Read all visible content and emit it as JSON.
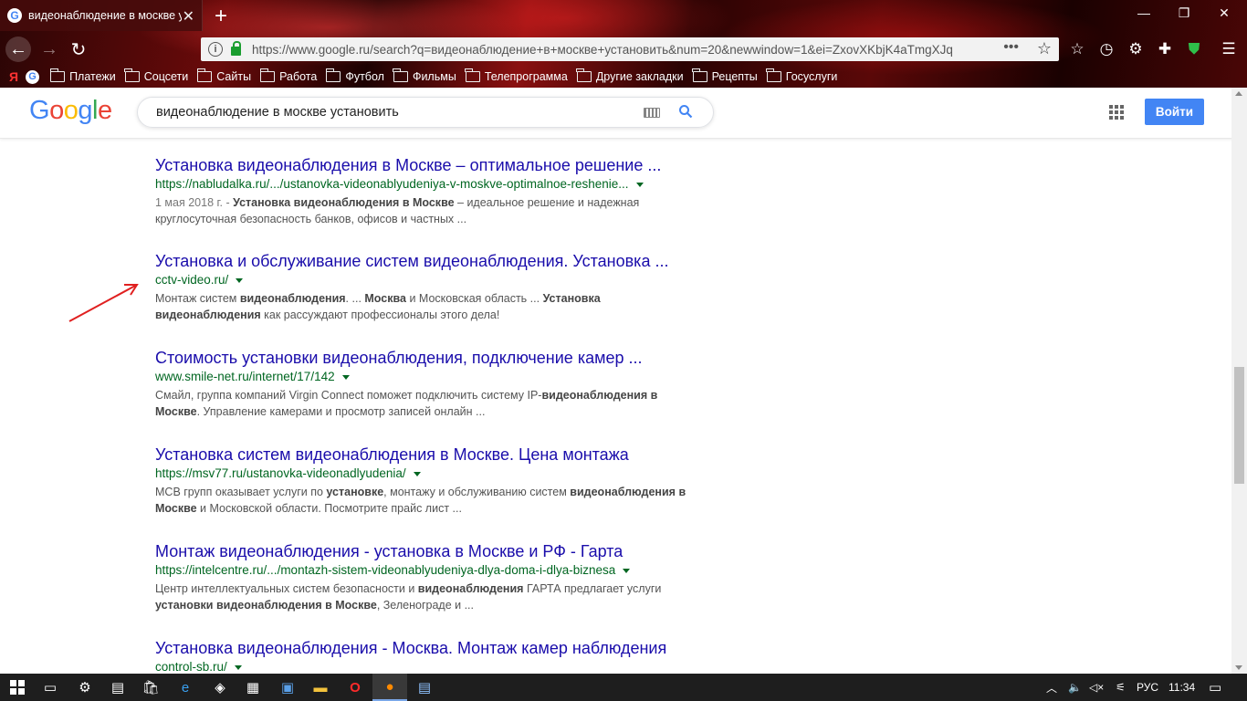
{
  "browser": {
    "tab_title": "видеонаблюдение в москве у",
    "tab_favicon": "G",
    "url": "https://www.google.ru/search?q=видеонаблюдение+в+москве+установить&num=20&newwindow=1&ei=ZxovXKbjK4aTmgXJq",
    "bookmarks": [
      {
        "label": "Платежи"
      },
      {
        "label": "Соцсети"
      },
      {
        "label": "Сайты"
      },
      {
        "label": "Работа"
      },
      {
        "label": "Футбол"
      },
      {
        "label": "Фильмы"
      },
      {
        "label": "Телепрограмма"
      },
      {
        "label": "Другие закладки"
      },
      {
        "label": "Рецепты"
      },
      {
        "label": "Госуслуги"
      }
    ],
    "bookmark_yandex": "Я",
    "bookmark_google": "G"
  },
  "google": {
    "logo_letters": [
      "G",
      "o",
      "o",
      "g",
      "l",
      "e"
    ],
    "query": "видеонаблюдение в москве установить",
    "signin_label": "Войти"
  },
  "results": [
    {
      "title": "Установка видеонаблюдения в Москве – оптимальное решение ...",
      "url": "https://nabludalka.ru/.../ustanovka-videonablyudeniya-v-moskve-optimalnoe-reshenie...",
      "snippet_html": "<span class=\"date\">1 мая 2018 г. - </span><b>Установка видеонаблюдения в Москве</b> – идеальное решение и надежная круглосуточная безопасность банков, офисов и частных ..."
    },
    {
      "title": "Установка и обслуживание систем видеонаблюдения. Установка ...",
      "url": "cctv-video.ru/",
      "snippet_html": "Монтаж систем <b>видеонаблюдения</b>. ... <b>Москва</b> и Московская область ... <b>Установка видеонаблюдения</b> как рассуждают профессионалы этого дела!"
    },
    {
      "title": "Стоимость установки видеонаблюдения, подключение камер ...",
      "url": "www.smile-net.ru/internet/17/142",
      "snippet_html": "Смайл, группа компаний Virgin Connect поможет подключить систему IP-<b>видеонаблюдения в Москве</b>. Управление камерами и просмотр записей онлайн ..."
    },
    {
      "title": "Установка систем видеонаблюдения в Москве. Цена монтажа",
      "url": "https://msv77.ru/ustanovka-videonadlyudenia/",
      "snippet_html": "МСВ групп оказывает услуги по <b>установке</b>, монтажу и обслуживанию систем <b>видеонаблюдения в Москве</b> и Московской области. Посмотрите прайс лист ..."
    },
    {
      "title": "Монтаж видеонаблюдения - установка в Москве и РФ - Гарта",
      "url": "https://intelcentre.ru/.../montazh-sistem-videonablyudeniya-dlya-doma-i-dlya-biznesa",
      "snippet_html": "Центр интеллектуальных систем безопасности и <b>видеонаблюдения</b> ГАРТА предлагает услуги <b>установки видеонаблюдения в Москве</b>, Зеленограде и ..."
    },
    {
      "title": "Установка видеонаблюдения - Москва. Монтаж камер наблюдения",
      "url": "control-sb.ru/",
      "snippet_html": ""
    }
  ],
  "taskbar": {
    "lang": "РУС",
    "time": "11:34"
  },
  "colors": {
    "link": "#1a0dab",
    "url_green": "#006621",
    "snippet": "#545454",
    "google_blue": "#4285f4",
    "annotation_arrow": "#e02020"
  }
}
